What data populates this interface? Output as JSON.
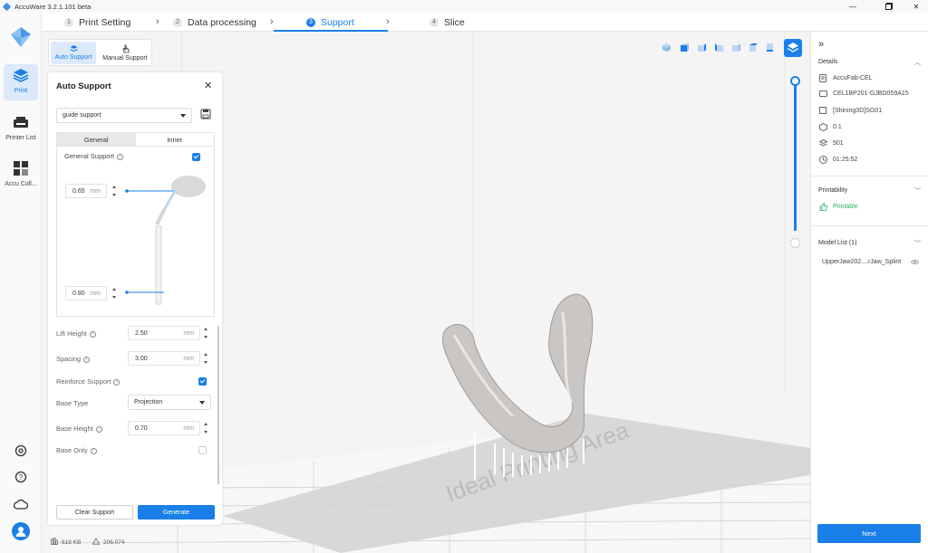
{
  "app": {
    "title": "AccuWare 3.2.1.101 beta"
  },
  "steps": [
    {
      "num": "1",
      "label": "Print Setting"
    },
    {
      "num": "2",
      "label": "Data processing"
    },
    {
      "num": "3",
      "label": "Support"
    },
    {
      "num": "4",
      "label": "Slice"
    }
  ],
  "rail": {
    "print": "Print",
    "printer_list": "Printer List",
    "accu_coll": "Accu Coll..."
  },
  "support_modes": {
    "auto": "Auto Support",
    "manual": "Manual Support"
  },
  "panel": {
    "title": "Auto Support",
    "preset": "guide support",
    "tabs": {
      "general": "General",
      "inner": "Inner"
    },
    "general_support": "General Support",
    "diameter_top": {
      "value": "0.65",
      "unit": "mm"
    },
    "diameter_bottom": {
      "value": "0.80",
      "unit": "mm"
    },
    "lift_height": {
      "label": "Lift Height",
      "value": "2.50",
      "unit": "mm"
    },
    "spacing": {
      "label": "Spacing",
      "value": "3.00",
      "unit": "mm"
    },
    "reinforce_support": "Reinforce Support",
    "base_type": {
      "label": "Base Type",
      "value": "Projection"
    },
    "base_height": {
      "label": "Base Height",
      "value": "0.70",
      "unit": "mm"
    },
    "base_only": "Base Only",
    "clear": "Clear Support",
    "generate": "Generate"
  },
  "status": {
    "size": "618 KB",
    "triangles": "206,074"
  },
  "viewport": {
    "watermark": "Ideal Printing Area"
  },
  "details": {
    "title": "Details",
    "printer": "AccuFab-CEL",
    "serial": "CEL1BP201-GJBD059A15",
    "material": "[Shining3D]SG01",
    "layer": "0.1",
    "layers": "501",
    "time": "01:25:52"
  },
  "printability": {
    "title": "Printability",
    "status": "Printable"
  },
  "model_list": {
    "title": "Model List (1)",
    "item": "UpperJaw202....rJaw_Splint"
  },
  "next": "Next",
  "colors": {
    "accent": "#1a7fe8",
    "printable": "#27ae60"
  }
}
